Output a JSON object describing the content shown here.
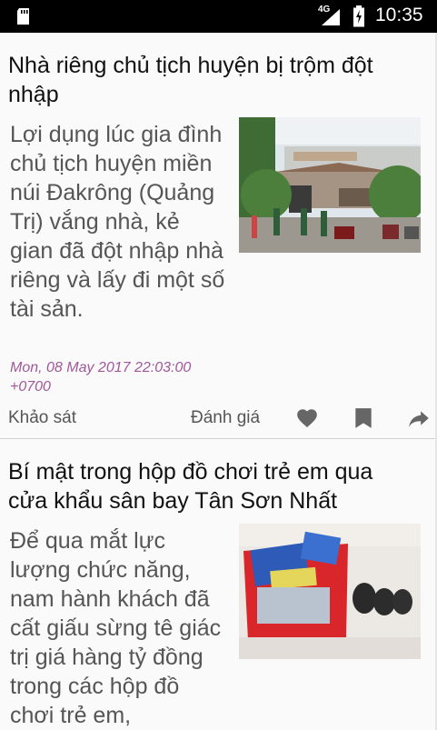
{
  "status_bar": {
    "network": "4G",
    "time": "10:35"
  },
  "articles": [
    {
      "title": "Nhà riêng chủ tịch huyện bị trộm đột nhập",
      "excerpt": " Lợi dụng lúc gia đình chủ tịch huyện miền núi Đakrông (Quảng Trị) vắng nhà, kẻ gian đã đột nhập nhà riêng và lấy đi một số tài sản.",
      "date": "Mon, 08 May 2017 22:03:00 +0700",
      "survey_label": "Khảo sát",
      "rate_label": "Đánh giá"
    },
    {
      "title": "Bí mật trong hộp đồ chơi trẻ em qua cửa khẩu sân bay Tân Sơn Nhất",
      "excerpt": " Để qua mắt lực lượng chức năng, nam hành khách đã cất giấu sừng tê giác trị giá hàng tỷ đồng trong các hộp đồ chơi trẻ em,"
    }
  ],
  "icons": {
    "like": "heart-icon",
    "bookmark": "bookmark-icon",
    "share": "share-icon"
  }
}
